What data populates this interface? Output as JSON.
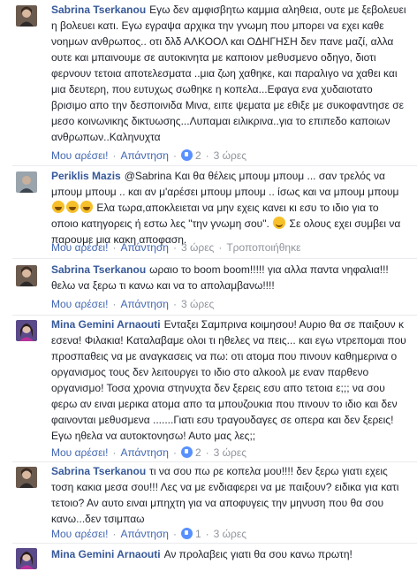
{
  "labels": {
    "like": "Μου αρέσει!",
    "reply": "Απάντηση",
    "edited": "Τροποποιήθηκε"
  },
  "comments": [
    {
      "author": "Sabrina Tserkanou",
      "text": "Εγω δεν αμφισβητω καμμια αληθεια, ουτε με ξεβολευει η βολευει κατι. Εγω εγραψα αρχικα την γνωμη που μπορει να εχει καθε νοημων ανθρωπος.. οτι δλδ ΑΛΚΟΟΛ και ΟΔΗΓΗΣΗ δεν πανε μαζί, αλλα ουτε και μπαινουμε σε αυτοκινητα με καποιον μεθυσμενο οδηγο, διοτι φερνουν τετοια αποτελεσματα ..μια ζωη χαθηκε, και παραλιγο να χαθει και μια δευτερη, που ευτυχως σωθηκε η κοπελα...Εφαγα ενα χυδαιοτατο βρισιμο απο την δεσποινιδα Μινα, ειπε ψεματα με εθιξε με συκοφαντησε σε μεσο κοινωνικης δικτυωσης...Λυπαμαι ειλικρινα..για το επιπεδο καποιων ανθρωπων..Καληνυχτα",
      "reactions": "2",
      "time": "3 ώρες"
    },
    {
      "author": "Periklis Mazis",
      "text_before": "@Sabrina Και θα θέλεις μπουμ μπουμ ... σαν τρελός να μπουμ μπουμ .. και αν μ'αρέσει μπουμ μπουμ .. ίσως και να μπουμ μπουμ",
      "text_middle": " Ελα τωρα,αποκλειεται να μην εχεις κανει κι εσυ το ιδιο για το οποιο κατηγορεις ή εστω λες \"την γνωμη σου\".",
      "text_after": " Σε ολους εχει συμβει να παρουμε μια κακη αποφαση.",
      "emoji_laugh": "laugh-emoji",
      "emoji_smile": "smile-emoji"
    },
    {
      "author": "Sabrina Tserkanou",
      "text": "ωραιο το boom boom!!!!! για αλλα παντα νηφαλια!!! θελω να ξερω τι κανω και να το απολαμβανω!!!!",
      "time": "3 ώρες"
    },
    {
      "author": "Mina Gemini Arnaouti",
      "text": "Ενταξει Σαμπρινα κοιμησου! Αυριο θα σε παιξουν κ εσενα! Φιλακια! Καταλαβαμε ολοι τι ηθελες να πεις... και εγω ντρεπομαι που προσπαθεις να με αναγκασεις να πω: οτι ατομα που πινουν καθημερινα ο οργανισμος τους δεν λειτουργει το ιδιο στο αλκοολ με εναν παρθενο οργανισμο! Τοσα χρονια στηνυχτα δεν ξερεις εσυ απο τετοια ε;;; να σου φερω αν ειναι μερικα ατομα απο τα μπουζουκια που πινουν το ιδιο και δεν φαινονται μεθυσμενα .......Γιατι εσυ τραγουδαγες σε οπερα και δεν ξερεις! Εγω ηθελα να αυτοκτονησω! Αυτο μας λες;;",
      "reactions": "2",
      "time": "3 ώρες"
    },
    {
      "author": "Sabrina Tserkanou",
      "text": "τι να σου πω ρε κοπελα μου!!!! δεν ξερω γιατι εχεις τοση κακια μεσα σου!!! Λες να με ενδιαφερει να με παιξουν? ειδικα για κατι τετοιο? Αν αυτο ειναι μπηχτη για να αποφυγεις την μηνυση που θα σου κανω...δεν τσιμπαω",
      "reactions": "1",
      "time": "3 ώρες"
    },
    {
      "author": "Mina Gemini Arnaouti",
      "text": "Αν προλαβεις γιατι θα σου κανω πρωτη!"
    }
  ]
}
